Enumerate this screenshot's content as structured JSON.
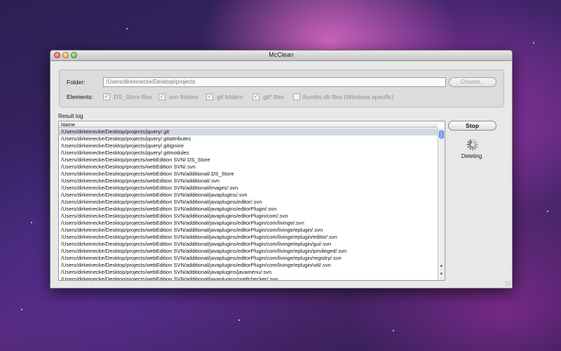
{
  "window": {
    "title": "McClean"
  },
  "folder": {
    "label": "Folder:",
    "value": "/Users/dirkeinecke/Desktop/projects",
    "choose_label": "Choose..."
  },
  "elements": {
    "label": "Elements:",
    "options": [
      {
        "label": ".DS_Store files",
        "checked": true
      },
      {
        "label": ".svn folders",
        "checked": true
      },
      {
        "label": ".git folders",
        "checked": true
      },
      {
        "label": ".git* files",
        "checked": true
      },
      {
        "label": "thumbs.db files (Windows specific)",
        "checked": false
      }
    ]
  },
  "result_log": {
    "label": "Result log",
    "column": "Name",
    "rows": [
      "/Users/dirkeinecke/Desktop/projects/jquery/.git",
      "/Users/dirkeinecke/Desktop/projects/jquery/.gitattributes",
      "/Users/dirkeinecke/Desktop/projects/jquery/.gitignore",
      "/Users/dirkeinecke/Desktop/projects/jquery/.gitmodules",
      "/Users/dirkeinecke/Desktop/projects/webEdition SVN/.DS_Store",
      "/Users/dirkeinecke/Desktop/projects/webEdition SVN/.svn",
      "/Users/dirkeinecke/Desktop/projects/webEdition SVN/additional/.DS_Store",
      "/Users/dirkeinecke/Desktop/projects/webEdition SVN/additional/.svn",
      "/Users/dirkeinecke/Desktop/projects/webEdition SVN/additional/images/.svn",
      "/Users/dirkeinecke/Desktop/projects/webEdition SVN/additional/javaplugins/.svn",
      "/Users/dirkeinecke/Desktop/projects/webEdition SVN/additional/javaplugins/editor/.svn",
      "/Users/dirkeinecke/Desktop/projects/webEdition SVN/additional/javaplugins/editorPlugin/.svn",
      "/Users/dirkeinecke/Desktop/projects/webEdition SVN/additional/javaplugins/editorPlugin/com/.svn",
      "/Users/dirkeinecke/Desktop/projects/webEdition SVN/additional/javaplugins/editorPlugin/com/livinge/.svn",
      "/Users/dirkeinecke/Desktop/projects/webEdition SVN/additional/javaplugins/editorPlugin/com/livinge/eplugin/.svn",
      "/Users/dirkeinecke/Desktop/projects/webEdition SVN/additional/javaplugins/editorPlugin/com/livinge/eplugin/editor/.svn",
      "/Users/dirkeinecke/Desktop/projects/webEdition SVN/additional/javaplugins/editorPlugin/com/livinge/eplugin/gui/.svn",
      "/Users/dirkeinecke/Desktop/projects/webEdition SVN/additional/javaplugins/editorPlugin/com/livinge/eplugin/privileged/.svn",
      "/Users/dirkeinecke/Desktop/projects/webEdition SVN/additional/javaplugins/editorPlugin/com/livinge/eplugin/registry/.svn",
      "/Users/dirkeinecke/Desktop/projects/webEdition SVN/additional/javaplugins/editorPlugin/com/livinge/eplugin/util/.svn",
      "/Users/dirkeinecke/Desktop/projects/webEdition SVN/additional/javaplugins/javamenu/.svn",
      "/Users/dirkeinecke/Desktop/projects/webEdition SVN/additional/javaplugins/spellchecker/.svn"
    ],
    "selected_index": 0
  },
  "actions": {
    "stop_label": "Stop",
    "status": "Deleting"
  },
  "icons": {
    "close": "close-traffic-light-icon",
    "minimize": "minimize-traffic-light-icon",
    "zoom": "zoom-traffic-light-icon",
    "spinner": "spinner-icon",
    "check": "checkmark-icon"
  }
}
